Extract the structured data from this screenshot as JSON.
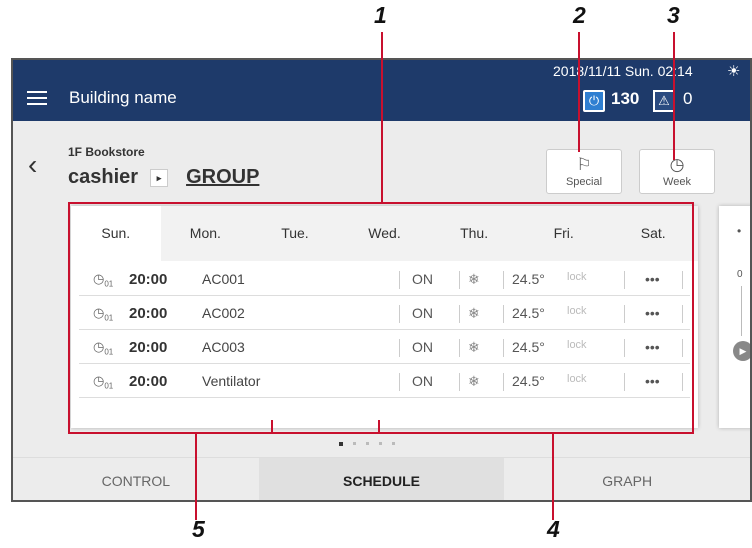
{
  "callouts": [
    "1",
    "2",
    "3",
    "4",
    "5"
  ],
  "topbar": {
    "building_name": "Building name",
    "datetime": "2018/11/11 Sun. 02:14",
    "sun_symbol": "☀",
    "power_count": "130",
    "warning_count": "0"
  },
  "header": {
    "location": "1F Bookstore",
    "path_current": "cashier",
    "path_arrow": "▸",
    "path_group": "GROUP",
    "back_symbol": "‹"
  },
  "buttons": {
    "special_label": "Special",
    "week_label": "Week"
  },
  "schedule": {
    "days": [
      "Sun.",
      "Mon.",
      "Tue.",
      "Wed.",
      "Thu.",
      "Fri.",
      "Sat."
    ],
    "active_day": "Sun.",
    "rows": [
      {
        "clock_sub": "01",
        "time": "20:00",
        "name": "AC001",
        "state": "ON",
        "mode_icon": "snowflake-icon",
        "temp": "24.5°",
        "lock": "lock",
        "more": "•••"
      },
      {
        "clock_sub": "01",
        "time": "20:00",
        "name": "AC002",
        "state": "ON",
        "mode_icon": "snowflake-icon",
        "temp": "24.5°",
        "lock": "lock",
        "more": "•••"
      },
      {
        "clock_sub": "01",
        "time": "20:00",
        "name": "AC003",
        "state": "ON",
        "mode_icon": "snowflake-icon",
        "temp": "24.5°",
        "lock": "lock",
        "more": "•••"
      },
      {
        "clock_sub": "01",
        "time": "20:00",
        "name": "Ventilator",
        "state": "ON",
        "mode_icon": "snowflake-icon",
        "temp": "24.5°",
        "lock": "lock",
        "more": "•••"
      }
    ]
  },
  "peek": {
    "value": "0"
  },
  "pager": {
    "pages": 5,
    "active": 1
  },
  "bottom_tabs": {
    "tabs": [
      "CONTROL",
      "SCHEDULE",
      "GRAPH"
    ],
    "active": "SCHEDULE"
  },
  "colors": {
    "topbar": "#1e3a6a",
    "callout_line": "#c8102e",
    "power_icon": "#2f7fd1"
  }
}
